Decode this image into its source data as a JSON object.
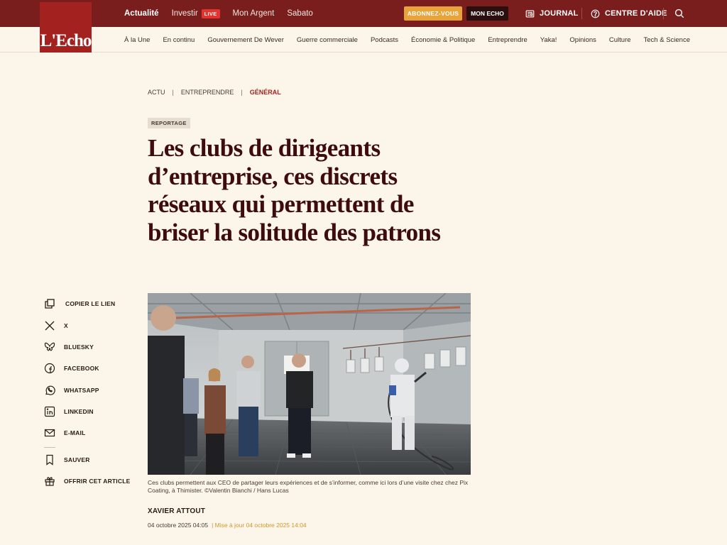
{
  "topnav": {
    "items": [
      {
        "label": "Actualité",
        "active": true
      },
      {
        "label": "Investir",
        "badge": "LIVE"
      },
      {
        "label": "Mon Argent"
      },
      {
        "label": "Sabato"
      }
    ],
    "subscribe": "ABONNEZ-VOUS",
    "mon_echo": "MON ECHO",
    "journal": "JOURNAL",
    "help": "CENTRE D'AIDE"
  },
  "logo": "L'Echo",
  "subnav": [
    "À la Une",
    "En continu",
    "Gouvernement De Wever",
    "Guerre commerciale",
    "Podcasts",
    "Économie & Politique",
    "Entreprendre",
    "Yaka!",
    "Opinions",
    "Culture",
    "Tech & Science"
  ],
  "breadcrumb": {
    "items": [
      "ACTU",
      "ENTREPRENDRE"
    ],
    "current": "GÉNÉRAL"
  },
  "article": {
    "tag": "REPORTAGE",
    "headline": "Les clubs de dirigeants d’entreprise, ces discrets réseaux qui permettent de briser la solitude des patrons",
    "caption": "Ces clubs permettent aux CEO de partager leurs expériences et de s’informer, comme ici lors d’une visite chez chez Pix Coating, à Thimister. ©Valentin Bianchi / Hans Lucas",
    "author": "XAVIER ATTOUT",
    "published": "04 octobre 2025 04:05",
    "updated": "| Mise à jour 04 octobre 2025 14:04"
  },
  "share": {
    "copy": "COPIER LE LIEN",
    "x": "X",
    "bluesky": "BLUESKY",
    "facebook": "FACEBOOK",
    "whatsapp": "WHATSAPP",
    "linkedin": "LINKEDIN",
    "email": "E-MAIL",
    "save": "SAUVER",
    "gift": "OFFRIR CET ARTICLE"
  },
  "colors": {
    "brand": "#7a1d1d",
    "logo": "#a3211e",
    "accent": "#e8a43a",
    "background": "#fcf6ea",
    "headline": "#3f0c0e"
  }
}
